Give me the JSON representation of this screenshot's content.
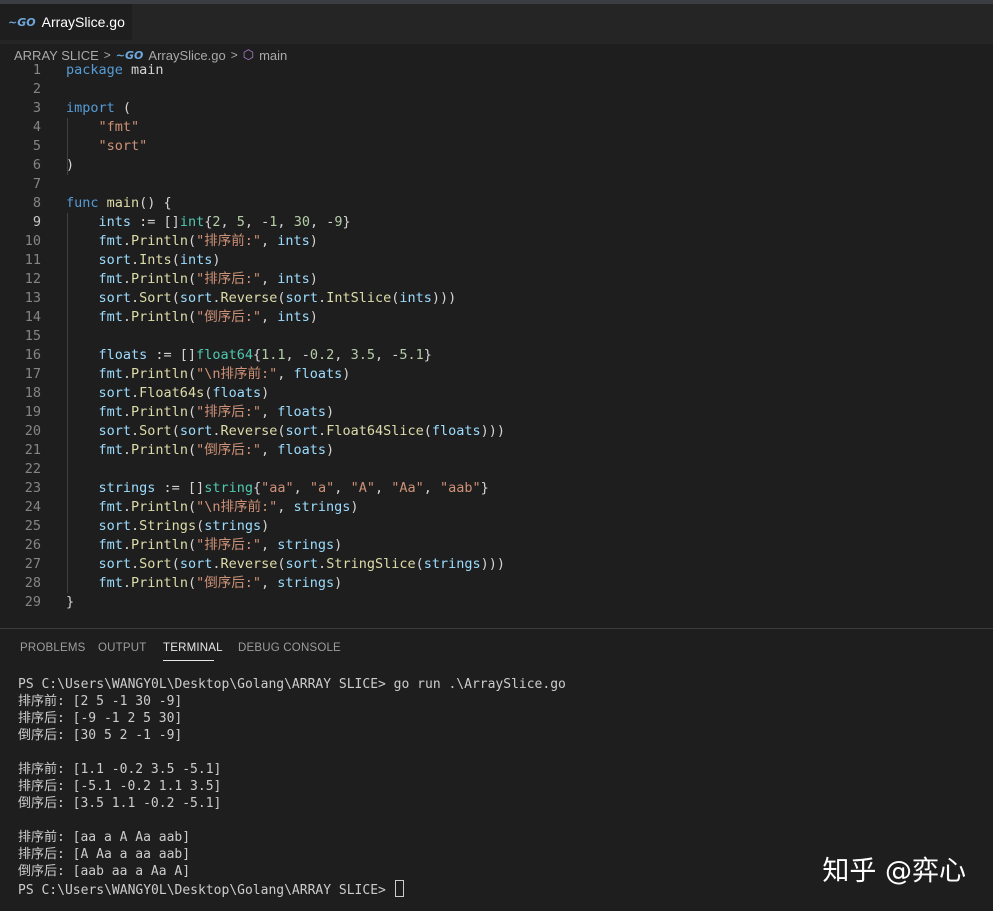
{
  "tab": {
    "filename": "ArraySlice.go",
    "icon": "go-file-icon"
  },
  "breadcrumb": {
    "folder": "ARRAY SLICE",
    "file": "ArraySlice.go",
    "symbol": "main"
  },
  "active_line": 9,
  "code_lines": [
    [
      [
        "kw",
        "package"
      ],
      [
        "plain",
        " main"
      ]
    ],
    [],
    [
      [
        "kw",
        "import"
      ],
      [
        "plain",
        " ("
      ]
    ],
    [
      [
        "plain",
        "    "
      ],
      [
        "str",
        "\"fmt\""
      ]
    ],
    [
      [
        "plain",
        "    "
      ],
      [
        "str",
        "\"sort\""
      ]
    ],
    [
      [
        "plain",
        ")"
      ]
    ],
    [],
    [
      [
        "kw",
        "func"
      ],
      [
        "plain",
        " "
      ],
      [
        "fn",
        "main"
      ],
      [
        "plain",
        "() {"
      ]
    ],
    [
      [
        "plain",
        "    "
      ],
      [
        "var",
        "ints"
      ],
      [
        "plain",
        " := []"
      ],
      [
        "pkg",
        "int"
      ],
      [
        "plain",
        "{"
      ],
      [
        "num",
        "2"
      ],
      [
        "plain",
        ", "
      ],
      [
        "num",
        "5"
      ],
      [
        "plain",
        ", -"
      ],
      [
        "num",
        "1"
      ],
      [
        "plain",
        ", "
      ],
      [
        "num",
        "30"
      ],
      [
        "plain",
        ", -"
      ],
      [
        "num",
        "9"
      ],
      [
        "plain",
        "}"
      ]
    ],
    [
      [
        "plain",
        "    "
      ],
      [
        "var",
        "fmt"
      ],
      [
        "plain",
        "."
      ],
      [
        "fn",
        "Println"
      ],
      [
        "plain",
        "("
      ],
      [
        "str",
        "\"排序前:\""
      ],
      [
        "plain",
        ", "
      ],
      [
        "var",
        "ints"
      ],
      [
        "plain",
        ")"
      ]
    ],
    [
      [
        "plain",
        "    "
      ],
      [
        "var",
        "sort"
      ],
      [
        "plain",
        "."
      ],
      [
        "fn",
        "Ints"
      ],
      [
        "plain",
        "("
      ],
      [
        "var",
        "ints"
      ],
      [
        "plain",
        ")"
      ]
    ],
    [
      [
        "plain",
        "    "
      ],
      [
        "var",
        "fmt"
      ],
      [
        "plain",
        "."
      ],
      [
        "fn",
        "Println"
      ],
      [
        "plain",
        "("
      ],
      [
        "str",
        "\"排序后:\""
      ],
      [
        "plain",
        ", "
      ],
      [
        "var",
        "ints"
      ],
      [
        "plain",
        ")"
      ]
    ],
    [
      [
        "plain",
        "    "
      ],
      [
        "var",
        "sort"
      ],
      [
        "plain",
        "."
      ],
      [
        "fn",
        "Sort"
      ],
      [
        "plain",
        "("
      ],
      [
        "var",
        "sort"
      ],
      [
        "plain",
        "."
      ],
      [
        "fn",
        "Reverse"
      ],
      [
        "plain",
        "("
      ],
      [
        "var",
        "sort"
      ],
      [
        "plain",
        "."
      ],
      [
        "fn",
        "IntSlice"
      ],
      [
        "plain",
        "("
      ],
      [
        "var",
        "ints"
      ],
      [
        "plain",
        ")))"
      ]
    ],
    [
      [
        "plain",
        "    "
      ],
      [
        "var",
        "fmt"
      ],
      [
        "plain",
        "."
      ],
      [
        "fn",
        "Println"
      ],
      [
        "plain",
        "("
      ],
      [
        "str",
        "\"倒序后:\""
      ],
      [
        "plain",
        ", "
      ],
      [
        "var",
        "ints"
      ],
      [
        "plain",
        ")"
      ]
    ],
    [],
    [
      [
        "plain",
        "    "
      ],
      [
        "var",
        "floats"
      ],
      [
        "plain",
        " := []"
      ],
      [
        "pkg",
        "float64"
      ],
      [
        "plain",
        "{"
      ],
      [
        "num",
        "1.1"
      ],
      [
        "plain",
        ", -"
      ],
      [
        "num",
        "0.2"
      ],
      [
        "plain",
        ", "
      ],
      [
        "num",
        "3.5"
      ],
      [
        "plain",
        ", -"
      ],
      [
        "num",
        "5.1"
      ],
      [
        "plain",
        "}"
      ]
    ],
    [
      [
        "plain",
        "    "
      ],
      [
        "var",
        "fmt"
      ],
      [
        "plain",
        "."
      ],
      [
        "fn",
        "Println"
      ],
      [
        "plain",
        "("
      ],
      [
        "str",
        "\"\\n排序前:\""
      ],
      [
        "plain",
        ", "
      ],
      [
        "var",
        "floats"
      ],
      [
        "plain",
        ")"
      ]
    ],
    [
      [
        "plain",
        "    "
      ],
      [
        "var",
        "sort"
      ],
      [
        "plain",
        "."
      ],
      [
        "fn",
        "Float64s"
      ],
      [
        "plain",
        "("
      ],
      [
        "var",
        "floats"
      ],
      [
        "plain",
        ")"
      ]
    ],
    [
      [
        "plain",
        "    "
      ],
      [
        "var",
        "fmt"
      ],
      [
        "plain",
        "."
      ],
      [
        "fn",
        "Println"
      ],
      [
        "plain",
        "("
      ],
      [
        "str",
        "\"排序后:\""
      ],
      [
        "plain",
        ", "
      ],
      [
        "var",
        "floats"
      ],
      [
        "plain",
        ")"
      ]
    ],
    [
      [
        "plain",
        "    "
      ],
      [
        "var",
        "sort"
      ],
      [
        "plain",
        "."
      ],
      [
        "fn",
        "Sort"
      ],
      [
        "plain",
        "("
      ],
      [
        "var",
        "sort"
      ],
      [
        "plain",
        "."
      ],
      [
        "fn",
        "Reverse"
      ],
      [
        "plain",
        "("
      ],
      [
        "var",
        "sort"
      ],
      [
        "plain",
        "."
      ],
      [
        "fn",
        "Float64Slice"
      ],
      [
        "plain",
        "("
      ],
      [
        "var",
        "floats"
      ],
      [
        "plain",
        ")))"
      ]
    ],
    [
      [
        "plain",
        "    "
      ],
      [
        "var",
        "fmt"
      ],
      [
        "plain",
        "."
      ],
      [
        "fn",
        "Println"
      ],
      [
        "plain",
        "("
      ],
      [
        "str",
        "\"倒序后:\""
      ],
      [
        "plain",
        ", "
      ],
      [
        "var",
        "floats"
      ],
      [
        "plain",
        ")"
      ]
    ],
    [],
    [
      [
        "plain",
        "    "
      ],
      [
        "var",
        "strings"
      ],
      [
        "plain",
        " := []"
      ],
      [
        "pkg",
        "string"
      ],
      [
        "plain",
        "{"
      ],
      [
        "str",
        "\"aa\""
      ],
      [
        "plain",
        ", "
      ],
      [
        "str",
        "\"a\""
      ],
      [
        "plain",
        ", "
      ],
      [
        "str",
        "\"A\""
      ],
      [
        "plain",
        ", "
      ],
      [
        "str",
        "\"Aa\""
      ],
      [
        "plain",
        ", "
      ],
      [
        "str",
        "\"aab\""
      ],
      [
        "plain",
        "}"
      ]
    ],
    [
      [
        "plain",
        "    "
      ],
      [
        "var",
        "fmt"
      ],
      [
        "plain",
        "."
      ],
      [
        "fn",
        "Println"
      ],
      [
        "plain",
        "("
      ],
      [
        "str",
        "\"\\n排序前:\""
      ],
      [
        "plain",
        ", "
      ],
      [
        "var",
        "strings"
      ],
      [
        "plain",
        ")"
      ]
    ],
    [
      [
        "plain",
        "    "
      ],
      [
        "var",
        "sort"
      ],
      [
        "plain",
        "."
      ],
      [
        "fn",
        "Strings"
      ],
      [
        "plain",
        "("
      ],
      [
        "var",
        "strings"
      ],
      [
        "plain",
        ")"
      ]
    ],
    [
      [
        "plain",
        "    "
      ],
      [
        "var",
        "fmt"
      ],
      [
        "plain",
        "."
      ],
      [
        "fn",
        "Println"
      ],
      [
        "plain",
        "("
      ],
      [
        "str",
        "\"排序后:\""
      ],
      [
        "plain",
        ", "
      ],
      [
        "var",
        "strings"
      ],
      [
        "plain",
        ")"
      ]
    ],
    [
      [
        "plain",
        "    "
      ],
      [
        "var",
        "sort"
      ],
      [
        "plain",
        "."
      ],
      [
        "fn",
        "Sort"
      ],
      [
        "plain",
        "("
      ],
      [
        "var",
        "sort"
      ],
      [
        "plain",
        "."
      ],
      [
        "fn",
        "Reverse"
      ],
      [
        "plain",
        "("
      ],
      [
        "var",
        "sort"
      ],
      [
        "plain",
        "."
      ],
      [
        "fn",
        "StringSlice"
      ],
      [
        "plain",
        "("
      ],
      [
        "var",
        "strings"
      ],
      [
        "plain",
        ")))"
      ]
    ],
    [
      [
        "plain",
        "    "
      ],
      [
        "var",
        "fmt"
      ],
      [
        "plain",
        "."
      ],
      [
        "fn",
        "Println"
      ],
      [
        "plain",
        "("
      ],
      [
        "str",
        "\"倒序后:\""
      ],
      [
        "plain",
        ", "
      ],
      [
        "var",
        "strings"
      ],
      [
        "plain",
        ")"
      ]
    ],
    [
      [
        "plain",
        "}"
      ]
    ]
  ],
  "panel_tabs": [
    {
      "label": "PROBLEMS",
      "active": false
    },
    {
      "label": "OUTPUT",
      "active": false
    },
    {
      "label": "TERMINAL",
      "active": true
    },
    {
      "label": "DEBUG CONSOLE",
      "active": false
    }
  ],
  "terminal_lines": [
    "PS C:\\Users\\WANGY0L\\Desktop\\Golang\\ARRAY SLICE> go run .\\ArraySlice.go",
    "排序前: [2 5 -1 30 -9]",
    "排序后: [-9 -1 2 5 30]",
    "倒序后: [30 5 2 -1 -9]",
    "",
    "排序前: [1.1 -0.2 3.5 -5.1]",
    "排序后: [-5.1 -0.2 1.1 3.5]",
    "倒序后: [3.5 1.1 -0.2 -5.1]",
    "",
    "排序前: [aa a A Aa aab]",
    "排序后: [A Aa a aa aab]",
    "倒序后: [aab aa a Aa A]"
  ],
  "terminal_prompt": "PS C:\\Users\\WANGY0L\\Desktop\\Golang\\ARRAY SLICE> ",
  "watermark": "知乎 @弈心"
}
